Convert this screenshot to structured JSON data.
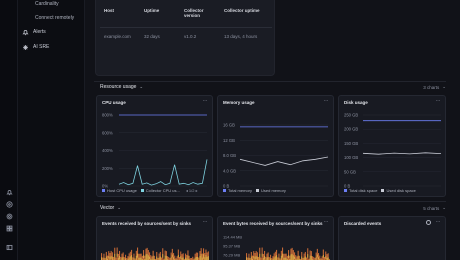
{
  "nav": {
    "items": [
      {
        "label": "Cardinality",
        "sub": true
      },
      {
        "label": "Connect remotely",
        "sub": true
      },
      {
        "label": "Alerts",
        "sub": false,
        "icon": "bell-icon"
      },
      {
        "label": "AI SRE",
        "sub": false,
        "icon": "sparkle-icon"
      }
    ]
  },
  "sidebar_icons": [
    "bell-icon",
    "help-icon",
    "settings-icon",
    "grid-icon",
    "panel-toggle-icon"
  ],
  "host_table": {
    "headers": [
      "Host",
      "Uptime",
      "Collector version",
      "Collector uptime"
    ],
    "row": [
      "example.com",
      "32 days",
      "v1.0.2",
      "13 days, 4 hours"
    ]
  },
  "resource_section": {
    "title": "Resource usage",
    "count": "3 charts"
  },
  "vector_section": {
    "title": "Vector",
    "count": "5 charts"
  },
  "colors": {
    "accent_blue": "#6d7ff5",
    "accent_teal": "#7fd3e0",
    "grey_line": "#c9ccd6",
    "orange": "#e0763a",
    "yellow": "#e6c14a"
  },
  "panels": {
    "cpu": {
      "title": "CPU usage",
      "legend": [
        "Host CPU usage",
        "Collector CPU us..."
      ],
      "chart_data": {
        "type": "line",
        "y_ticks": [
          "800%",
          "600%",
          "400%",
          "200%",
          "0%"
        ],
        "ylim": [
          0,
          800
        ],
        "series": [
          {
            "name": "Host CPU usage",
            "values": [
              800,
              800,
              800,
              800,
              800,
              800,
              800,
              800,
              800,
              800
            ]
          },
          {
            "name": "Collector CPU us...",
            "values": [
              20,
              40,
              15,
              30,
              230,
              20,
              35,
              10,
              25,
              50,
              15,
              30,
              240,
              20,
              30,
              15,
              40,
              20,
              30,
              300
            ]
          }
        ]
      }
    },
    "memory": {
      "title": "Memory usage",
      "legend": [
        "Total memory",
        "Used memory"
      ],
      "chart_data": {
        "type": "line",
        "y_ticks": [
          "16 GB",
          "12 GB",
          "8.0 GB",
          "4.0 GB",
          "0 B"
        ],
        "ylim": [
          0,
          16
        ],
        "series": [
          {
            "name": "Total memory",
            "values": [
              15.5,
              15.5,
              15.5,
              15.5,
              15.5,
              15.5,
              15.5,
              15.5
            ]
          },
          {
            "name": "Used memory",
            "values": [
              7.0,
              6.2,
              5.4,
              6.4,
              5.6,
              6.6,
              7.0,
              7.6
            ]
          }
        ]
      }
    },
    "disk": {
      "title": "Disk usage",
      "legend": [
        "Total disk space",
        "Used disk space"
      ],
      "chart_data": {
        "type": "line",
        "y_ticks": [
          "250 GB",
          "200 GB",
          "150 GB",
          "100 GB",
          "50 GB",
          "0 B"
        ],
        "ylim": [
          0,
          250
        ],
        "series": [
          {
            "name": "Total disk space",
            "values": [
              230,
              230,
              230,
              230,
              230,
              230
            ]
          },
          {
            "name": "Used disk space",
            "values": [
              115,
              112,
              116,
              113,
              117,
              114
            ]
          }
        ]
      }
    },
    "events": {
      "title": "Events received by sources/sent by sinks"
    },
    "bytes": {
      "title": "Event bytes received by sources/sent by sinks",
      "y_ticks": [
        "114.44 MB",
        "95.37 MB",
        "76.29 MB",
        "57.22 MB"
      ]
    },
    "discarded": {
      "title": "Discarded events"
    }
  }
}
